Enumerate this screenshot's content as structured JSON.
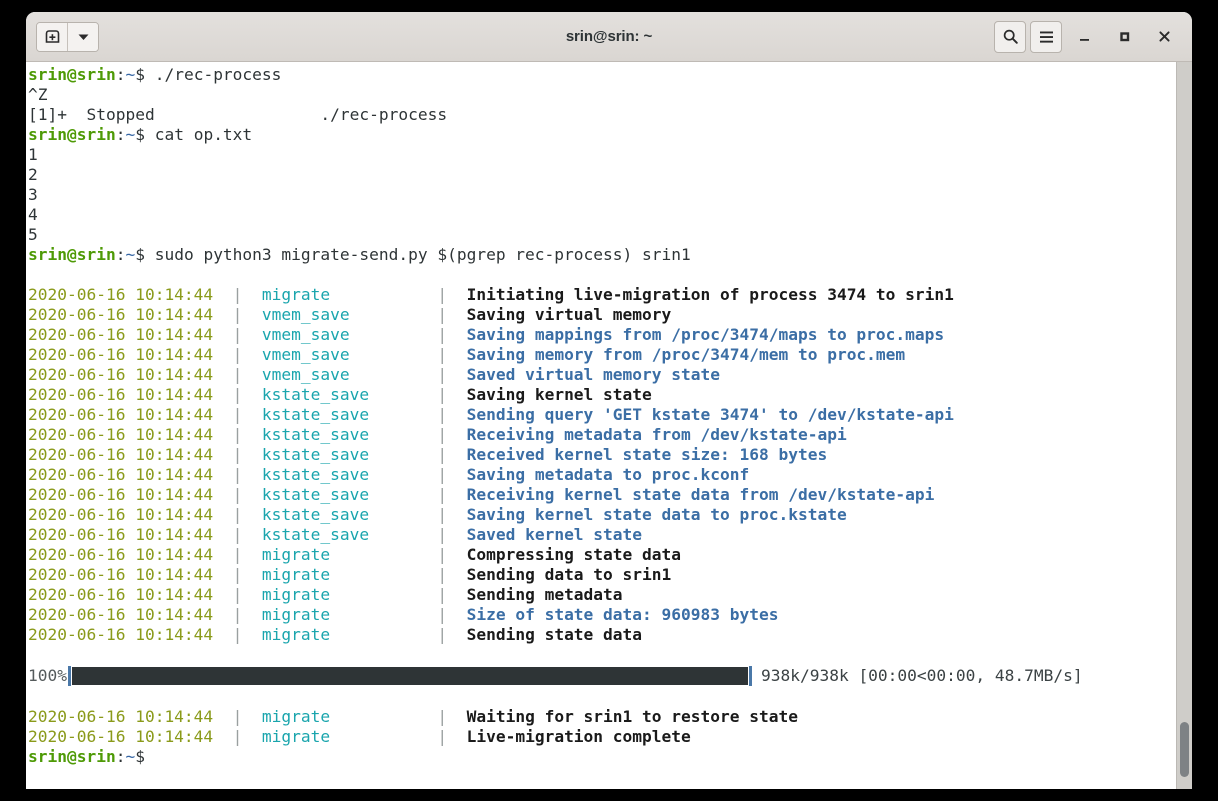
{
  "window": {
    "title": "srin@srin: ~",
    "titlebar": {
      "new_tab_icon": "new-tab-icon",
      "dropdown_icon": "chevron-down-icon",
      "search_icon": "search-icon",
      "menu_icon": "hamburger-menu-icon",
      "minimize_label": "–",
      "maximize_label": "□",
      "close_label": "×"
    }
  },
  "colors": {
    "prompt_user": "#4e9a06",
    "prompt_path": "#3465a4",
    "log_timestamp": "#8a9a1a",
    "log_module": "#1aa5ad",
    "log_message_blue": "#3b6ea5",
    "log_message_dark": "#1a1a1a",
    "progress_fill": "#2e3436",
    "progress_edge": "#4a78a8",
    "terminal_bg": "#ffffff",
    "titlebar_bg": "#dad6d2"
  },
  "terminal": {
    "prompt": {
      "user_host": "srin@srin",
      "colon": ":",
      "path": "~",
      "dollar": "$"
    },
    "commands": {
      "cmd1": " ./rec-process",
      "cmd2": " cat op.txt",
      "cmd3": " sudo python3 migrate-send.py $(pgrep rec-process) srin1"
    },
    "output": {
      "suspend_marker": "^Z",
      "job_status": "[1]+  Stopped                 ./rec-process",
      "cat_lines": [
        "1",
        "2",
        "3",
        "4",
        "5"
      ]
    },
    "log_lines": [
      {
        "ts": "2020-06-16 10:14:44",
        "module": "migrate",
        "msg": "Initiating live-migration of process 3474 to srin1",
        "style": "dark"
      },
      {
        "ts": "2020-06-16 10:14:44",
        "module": "vmem_save",
        "msg": "Saving virtual memory",
        "style": "dark"
      },
      {
        "ts": "2020-06-16 10:14:44",
        "module": "vmem_save",
        "msg": "Saving mappings from /proc/3474/maps to proc.maps",
        "style": "blue"
      },
      {
        "ts": "2020-06-16 10:14:44",
        "module": "vmem_save",
        "msg": "Saving memory from /proc/3474/mem to proc.mem",
        "style": "blue"
      },
      {
        "ts": "2020-06-16 10:14:44",
        "module": "vmem_save",
        "msg": "Saved virtual memory state",
        "style": "blue"
      },
      {
        "ts": "2020-06-16 10:14:44",
        "module": "kstate_save",
        "msg": "Saving kernel state",
        "style": "dark"
      },
      {
        "ts": "2020-06-16 10:14:44",
        "module": "kstate_save",
        "msg": "Sending query 'GET kstate 3474' to /dev/kstate-api",
        "style": "blue"
      },
      {
        "ts": "2020-06-16 10:14:44",
        "module": "kstate_save",
        "msg": "Receiving metadata from /dev/kstate-api",
        "style": "blue"
      },
      {
        "ts": "2020-06-16 10:14:44",
        "module": "kstate_save",
        "msg": "Received kernel state size: 168 bytes",
        "style": "blue"
      },
      {
        "ts": "2020-06-16 10:14:44",
        "module": "kstate_save",
        "msg": "Saving metadata to proc.kconf",
        "style": "blue"
      },
      {
        "ts": "2020-06-16 10:14:44",
        "module": "kstate_save",
        "msg": "Receiving kernel state data from /dev/kstate-api",
        "style": "blue"
      },
      {
        "ts": "2020-06-16 10:14:44",
        "module": "kstate_save",
        "msg": "Saving kernel state data to proc.kstate",
        "style": "blue"
      },
      {
        "ts": "2020-06-16 10:14:44",
        "module": "kstate_save",
        "msg": "Saved kernel state",
        "style": "blue"
      },
      {
        "ts": "2020-06-16 10:14:44",
        "module": "migrate",
        "msg": "Compressing state data",
        "style": "dark"
      },
      {
        "ts": "2020-06-16 10:14:44",
        "module": "migrate",
        "msg": "Sending data to srin1",
        "style": "dark"
      },
      {
        "ts": "2020-06-16 10:14:44",
        "module": "migrate",
        "msg": "Sending metadata",
        "style": "dark"
      },
      {
        "ts": "2020-06-16 10:14:44",
        "module": "migrate",
        "msg": "Size of state data: 960983 bytes",
        "style": "blue"
      },
      {
        "ts": "2020-06-16 10:14:44",
        "module": "migrate",
        "msg": "Sending state data",
        "style": "dark"
      }
    ],
    "progress": {
      "percent_label": "100%",
      "percent_value": 100,
      "stats": "938k/938k [00:00<00:00, 48.7MB/s]"
    },
    "log_lines_tail": [
      {
        "ts": "2020-06-16 10:14:44",
        "module": "migrate",
        "msg": "Waiting for srin1 to restore state",
        "style": "dark"
      },
      {
        "ts": "2020-06-16 10:14:44",
        "module": "migrate",
        "msg": "Live-migration complete",
        "style": "dark"
      }
    ]
  }
}
